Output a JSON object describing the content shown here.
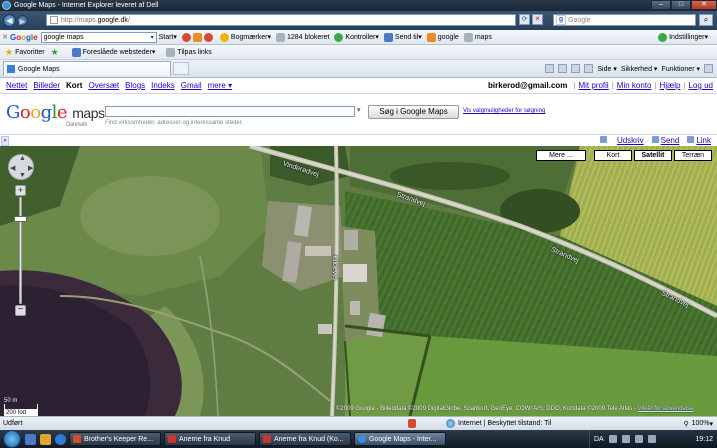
{
  "window": {
    "title": "Google Maps - Internet Explorer leveret af Dell"
  },
  "address_bar": {
    "url_prefix": "http://maps.",
    "url_domain": "google.dk",
    "url_suffix": "/",
    "search_placeholder": "Google"
  },
  "google_toolbar": {
    "search_value": "google maps",
    "start_label": "Start",
    "bookmarks_label": "Bogmærker",
    "blocked_label": "1284 blokeret",
    "checks_label": "Kontroller",
    "sendto_label": "Send til",
    "google_label": "google",
    "maps_label": "maps",
    "settings_label": "Indstillinger"
  },
  "favorites_bar": {
    "favorites_label": "Favoritter",
    "suggested_label": "Foreslåede websteder",
    "addons_label": "Tilpas links"
  },
  "tabs": {
    "active_tab": "Google Maps"
  },
  "command_bar": {
    "page_label": "Side",
    "security_label": "Sikkerhed",
    "functions_label": "Funktioner"
  },
  "topnav": {
    "links": [
      "Nettet",
      "Billeder",
      "Kort",
      "Oversæt",
      "Blogs",
      "Indeks",
      "Gmail",
      "mere ▾"
    ],
    "current": "Kort",
    "email": "birkerod@gmail.com",
    "profile_link": "Mit profil",
    "account_link": "Min konto",
    "help_link": "Hjælp",
    "logout_link": "Log ud"
  },
  "maps_header": {
    "logo_sub": "Danmark",
    "search_button": "Søg i Google Maps",
    "options_link": "Vis valgmuligheder for søgning",
    "hint": "Find virksomheder, adresser og interessante steder."
  },
  "link_bar": {
    "print": "Udskriv",
    "send": "Send",
    "link": "Link"
  },
  "map": {
    "types": [
      "Mere ...",
      "Kort",
      "Satellit",
      "Terræn"
    ],
    "active_type": "Satellit",
    "road_labels": [
      "Vinderødvej",
      "Strandvej",
      "Strandvej",
      "Strandvej"
    ],
    "road_label_vertical": "Kildevej",
    "scale_m": "50 m",
    "scale_ft": "200 fod",
    "copyright": "©2009 Google - Billeddata ©2009 DigitalGlobe, Scankort, GeoEye, COWI A/S, DDO, Kortdata ©2009 Tele Atlas -",
    "terms_link": "Vilkår for anvendelse"
  },
  "status_bar": {
    "left": "Udført",
    "zone": "Internet | Beskyttet tilstand: Til",
    "zoom": "100%"
  },
  "taskbar": {
    "items": [
      "Brother's Keeper Re...",
      "Anerne fra Knud",
      "Anerne fra Knud (Ko...",
      "Google Maps - Inter..."
    ],
    "active_index": 3,
    "lang": "DA",
    "clock": "19:12"
  }
}
